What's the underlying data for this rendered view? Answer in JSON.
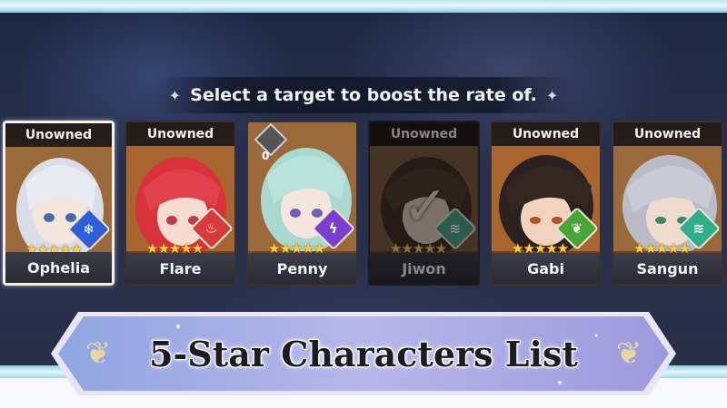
{
  "prompt": {
    "text": "Select a target to boost the rate of.",
    "left_sparkle": "✦",
    "right_sparkle": "✦"
  },
  "characters": [
    {
      "name": "Ophelia",
      "status": "Unowned",
      "stars": "★★★★★",
      "element_icon": "snowflake-icon",
      "element_glyph": "❄",
      "element_color": "#2f5fd6",
      "selected": true
    },
    {
      "name": "Flare",
      "status": "Unowned",
      "stars": "★★★★★",
      "element_icon": "fire-icon",
      "element_glyph": "♨",
      "element_color": "#d63a3a",
      "selected": false
    },
    {
      "name": "Penny",
      "status": "",
      "stars": "★★★★★",
      "element_icon": "lightning-icon",
      "element_glyph": "ϟ",
      "element_color": "#7b3fd0",
      "selected": false,
      "count": "0"
    },
    {
      "name": "Jiwon",
      "status": "Unowned",
      "stars": "★★★★★",
      "element_icon": "wind-icon",
      "element_glyph": "≋",
      "element_color": "#2fae8a",
      "selected": false,
      "dim": true
    },
    {
      "name": "Gabi",
      "status": "Unowned",
      "stars": "★★★★★",
      "element_icon": "leaf-icon",
      "element_glyph": "❦",
      "element_color": "#49a43a",
      "selected": false
    },
    {
      "name": "Sangun",
      "status": "Unowned",
      "stars": "★★★★★",
      "element_icon": "wind-icon",
      "element_glyph": "≋",
      "element_color": "#2fae8a",
      "selected": false
    }
  ],
  "banner": {
    "title": "5-Star Characters List"
  }
}
